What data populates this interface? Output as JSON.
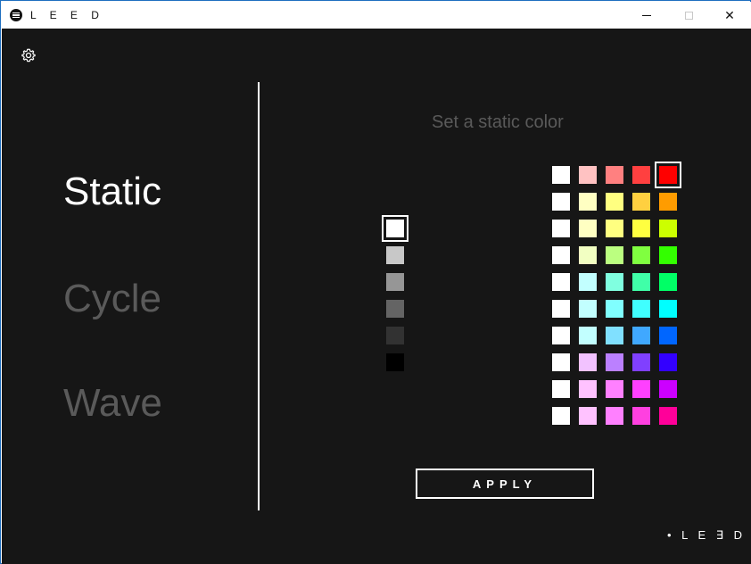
{
  "window": {
    "title": "L E E D",
    "controls": {
      "minimize": "",
      "maximize": "",
      "close": "✕"
    }
  },
  "sidebar": {
    "modes": [
      {
        "label": "Static",
        "active": true
      },
      {
        "label": "Cycle",
        "active": false
      },
      {
        "label": "Wave",
        "active": false
      }
    ]
  },
  "main": {
    "prompt": "Set a static color",
    "grays": [
      "#ffffff",
      "#c8c8c8",
      "#969696",
      "#646464",
      "#323232",
      "#000000"
    ],
    "selected_gray": 0,
    "palette": [
      [
        "#ffffff",
        "#ffc2c2",
        "#ff8080",
        "#ff4040",
        "#ff0000"
      ],
      [
        "#ffffff",
        "#ffffc2",
        "#ffff80",
        "#ffd040",
        "#ff9c00"
      ],
      [
        "#ffffff",
        "#ffffc2",
        "#ffff80",
        "#ffff40",
        "#ccff00"
      ],
      [
        "#ffffff",
        "#f2ffc2",
        "#bbff80",
        "#80ff40",
        "#33ff00"
      ],
      [
        "#ffffff",
        "#c2ffff",
        "#80ffe0",
        "#40ffa8",
        "#00ff66"
      ],
      [
        "#ffffff",
        "#c2ffff",
        "#80ffff",
        "#40ffff",
        "#00ffff"
      ],
      [
        "#ffffff",
        "#c2ffff",
        "#80e0ff",
        "#40a8ff",
        "#0066ff"
      ],
      [
        "#ffffff",
        "#f2c2ff",
        "#bb80ff",
        "#8040ff",
        "#3300ff"
      ],
      [
        "#ffffff",
        "#ffc2ff",
        "#ff80ff",
        "#ff40ff",
        "#cc00ff"
      ],
      [
        "#ffffff",
        "#ffc2ff",
        "#ff80ff",
        "#ff40e0",
        "#ff0099"
      ]
    ],
    "selected_palette": [
      0,
      4
    ],
    "apply_label": "APPLY"
  },
  "brand": "• L E ∃ D •",
  "icons": {
    "settings": "gear-icon"
  }
}
